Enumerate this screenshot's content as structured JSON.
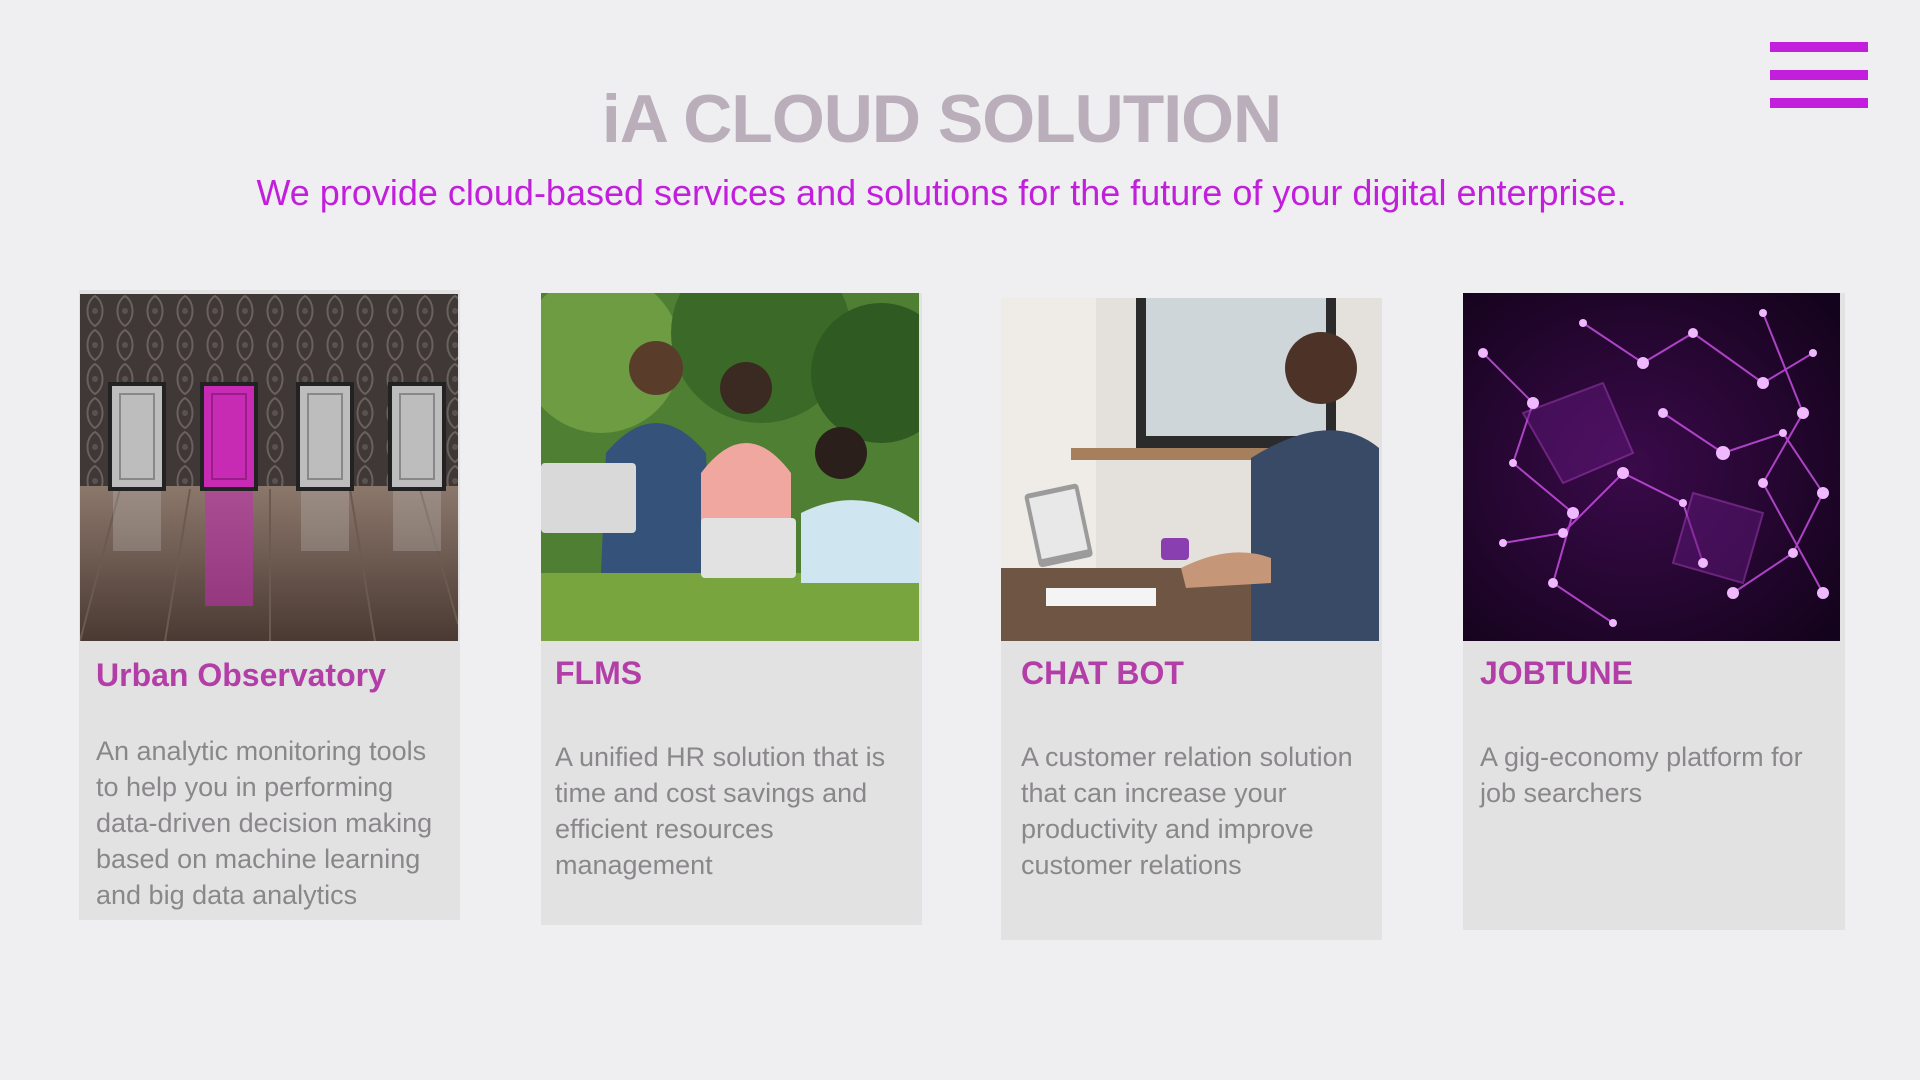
{
  "header": {
    "title": "iA CLOUD SOLUTION",
    "tagline": "We provide cloud-based services and solutions for the future of your digital enterprise.",
    "menu_icon": "hamburger-menu-icon"
  },
  "colors": {
    "background": "#efeef1",
    "accent": "#c21fdc",
    "title": "#b9aeba",
    "card_bg": "#e3e2e3",
    "card_title": "#b43ea8",
    "card_text": "#8a878b"
  },
  "cards": [
    {
      "name": "Urban Observatory",
      "description": "An analytic monitoring tools to help you  in performing data-driven decision making based on machine learning and big data analytics",
      "image": "doors-photo"
    },
    {
      "name": "FLMS",
      "description": "A unified HR solution that is time and cost savings and efficient resources management",
      "image": "students-laptops-photo"
    },
    {
      "name": "CHAT BOT",
      "description": "A customer relation solution that can increase your productivity and improve customer relations",
      "image": "man-laptop-photo"
    },
    {
      "name": "JOBTUNE",
      "description": "A gig-economy platform for job searchers",
      "image": "network-nodes-photo"
    }
  ]
}
